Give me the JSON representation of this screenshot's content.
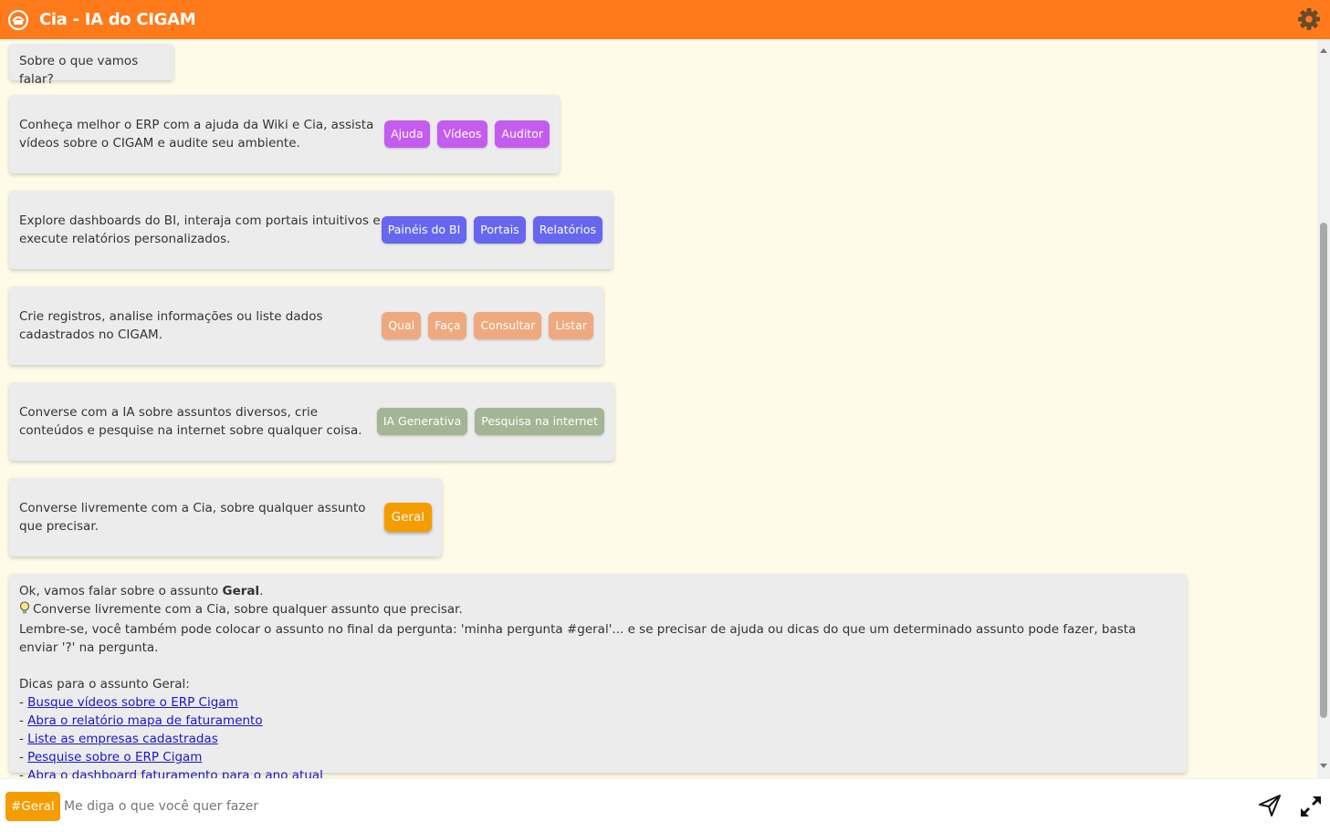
{
  "header": {
    "title": "Cia - IA do CIGAM"
  },
  "greeting": "Sobre o que vamos falar?",
  "cards": [
    {
      "text": "Conheça melhor o ERP com a ajuda da Wiki e Cia, assista vídeos sobre o CIGAM e audite seu ambiente.",
      "buttons": [
        "Ajuda",
        "Vídeos",
        "Auditor"
      ],
      "color": "#c45cf0"
    },
    {
      "text": "Explore dashboards do BI, interaja com portais intuitivos e execute relatórios personalizados.",
      "buttons": [
        "Painéis do BI",
        "Portais",
        "Relatórios"
      ],
      "color": "#6666ee"
    },
    {
      "text": "Crie registros, analise informações ou liste dados cadastrados no CIGAM.",
      "buttons": [
        "Qual",
        "Faça",
        "Consultar",
        "Listar"
      ],
      "color": "#eea97f"
    },
    {
      "text": "Converse com a IA sobre assuntos diversos, crie conteúdos e pesquise na internet sobre qualquer coisa.",
      "buttons": [
        "IA Generativa",
        "Pesquisa na internet"
      ],
      "color": "#a3b595"
    },
    {
      "text": "Converse livremente com a Cia, sobre qualquer assunto que precisar.",
      "buttons": [
        "Geral"
      ],
      "color": "#f59c00"
    }
  ],
  "response": {
    "intro_prefix": "Ok, vamos falar sobre o assunto ",
    "intro_subject": "Geral",
    "intro_suffix": ".",
    "tip_line": "Converse livremente com a Cia, sobre qualquer assunto que precisar.",
    "reminder": "Lembre-se, você também pode colocar o assunto no final da pergunta: 'minha pergunta #geral'... e se precisar de ajuda ou dicas do que um determinado assunto pode fazer, basta enviar '?' na pergunta.",
    "tips_heading": "Dicas para o assunto Geral:",
    "links": [
      "Busque vídeos sobre o ERP Cigam",
      "Abra o relatório mapa de faturamento",
      "Liste as empresas cadastradas",
      "Pesquise sobre o ERP Cigam",
      "Abra o dashboard faturamento para o ano atual"
    ]
  },
  "input": {
    "tag": "#Geral",
    "placeholder": "Me diga o que você quer fazer"
  },
  "colors": {
    "accent": "#ff7a1a",
    "background": "#fffbe8",
    "link": "#1a16c8"
  }
}
